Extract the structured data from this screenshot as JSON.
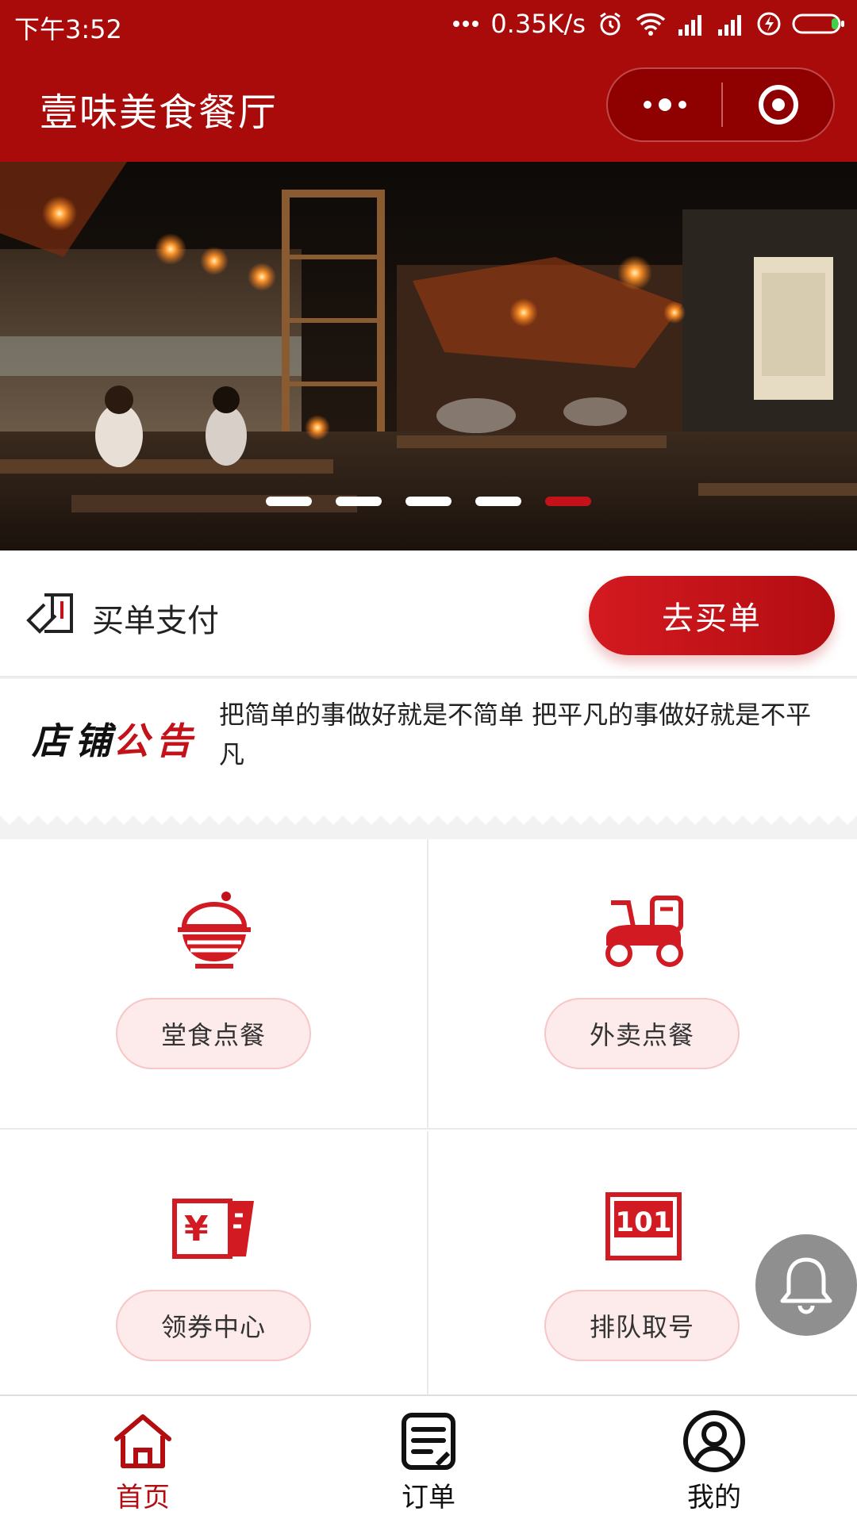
{
  "status_bar": {
    "time": "下午3:52",
    "network_speed": "0.35K/s"
  },
  "header": {
    "title": "壹味美食餐厅"
  },
  "banner": {
    "slide_count": 5,
    "active_index": 4,
    "accent_color": "#c4121a"
  },
  "pay": {
    "label": "买单支付",
    "button_label": "去买单"
  },
  "notice": {
    "logo_text": "店铺公告",
    "text": "把简单的事做好就是不简单 把平凡的事做好就是不平凡"
  },
  "services": [
    {
      "label": "堂食点餐",
      "icon": "rice-bowl-icon"
    },
    {
      "label": "外卖点餐",
      "icon": "scooter-icon"
    },
    {
      "label": "领券中心",
      "icon": "coupon-icon"
    },
    {
      "label": "排队取号",
      "icon": "queue-ticket-icon"
    }
  ],
  "tabbar": {
    "items": [
      {
        "label": "首页",
        "icon": "home-icon",
        "active": true
      },
      {
        "label": "订单",
        "icon": "order-icon",
        "active": false
      },
      {
        "label": "我的",
        "icon": "profile-icon",
        "active": false
      }
    ]
  },
  "colors": {
    "brand": "#a90a0a",
    "accent": "#c4121a"
  }
}
